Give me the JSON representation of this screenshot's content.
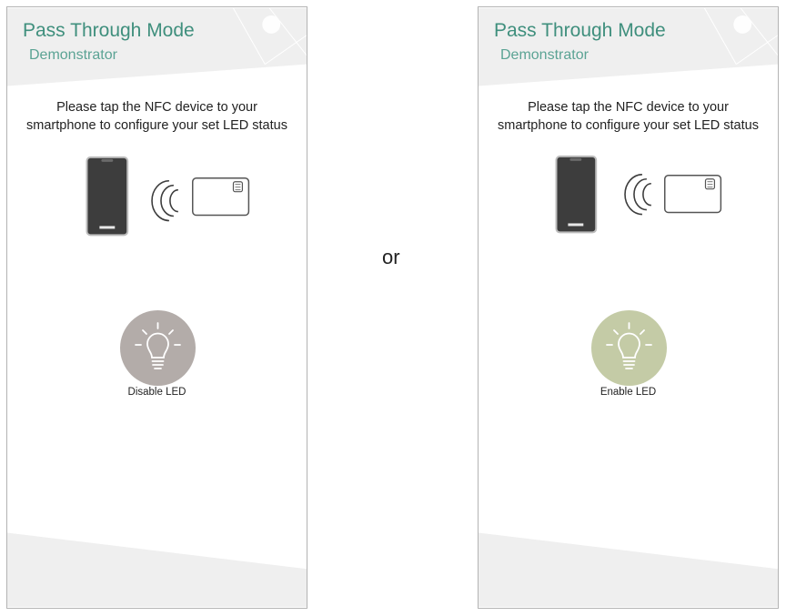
{
  "screens": [
    {
      "title": "Pass Through Mode",
      "subtitle": "Demonstrator",
      "instruction_line1": "Please tap the NFC device to your",
      "instruction_line2": "smartphone to configure your set LED status",
      "led_button_label": "Disable LED",
      "led_color": "#b3aca9",
      "icons": [
        "smartphone-icon",
        "nfc-waves-icon",
        "nfc-card-icon",
        "lightbulb-icon"
      ]
    },
    {
      "title": "Pass Through Mode",
      "subtitle": "Demonstrator",
      "instruction_line1": "Please tap the NFC device to your",
      "instruction_line2": "smartphone to configure your set LED status",
      "led_button_label": "Enable LED",
      "led_color": "#c4cba6",
      "icons": [
        "smartphone-icon",
        "nfc-waves-icon",
        "nfc-card-icon",
        "lightbulb-icon"
      ]
    }
  ],
  "separator_text": "or",
  "colors": {
    "title": "#3f8f7d",
    "subtitle": "#5ba394",
    "header_band": "#efefef"
  }
}
